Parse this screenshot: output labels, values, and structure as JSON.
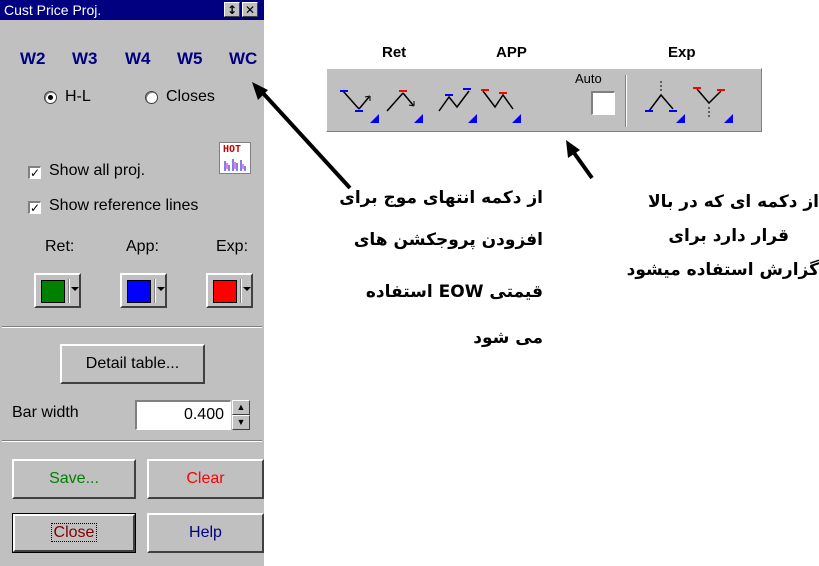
{
  "window": {
    "title": "Cust Price Proj."
  },
  "titlebar_buttons": {
    "size_glyph": "↕",
    "close_glyph": "✕"
  },
  "wave_tabs": [
    "W2",
    "W3",
    "W4",
    "W5",
    "WC"
  ],
  "price_mode": {
    "options": [
      "H-L",
      "Closes"
    ],
    "selected": "H-L"
  },
  "hot_badge": "HOT",
  "checkboxes": [
    {
      "label": "Show all proj.",
      "checked": true
    },
    {
      "label": "Show reference lines",
      "checked": true
    }
  ],
  "colors": {
    "labels": [
      "Ret:",
      "App:",
      "Exp:"
    ],
    "values": [
      "#008000",
      "#0000ff",
      "#ff0000"
    ]
  },
  "detail_button": "Detail table...",
  "bar_width": {
    "label": "Bar width",
    "value": "0.400"
  },
  "buttons": {
    "save": "Save...",
    "clear": "Clear",
    "close": "Close",
    "help": "Help"
  },
  "button_colors": {
    "save": "#008000",
    "clear": "#ff0000",
    "close": "#800000",
    "help": "#000080"
  },
  "toolbar": {
    "group_labels": {
      "ret": "Ret",
      "app": "APP",
      "exp": "Exp"
    },
    "auto_label": "Auto",
    "tools": [
      "ret-down-tool",
      "ret-up-tool",
      "app-up-tool",
      "app-down-tool",
      "exp-up-tool",
      "exp-down-tool"
    ]
  },
  "annotations": {
    "left": [
      "از دکمه انتهای موج برای",
      "افزودن پروجکشن های",
      "قیمتی EOW استفاده",
      "می شود"
    ],
    "right": [
      "از دکمه ای که در بالا",
      "قرار دارد برای",
      "گزارش استفاده میشود"
    ]
  }
}
